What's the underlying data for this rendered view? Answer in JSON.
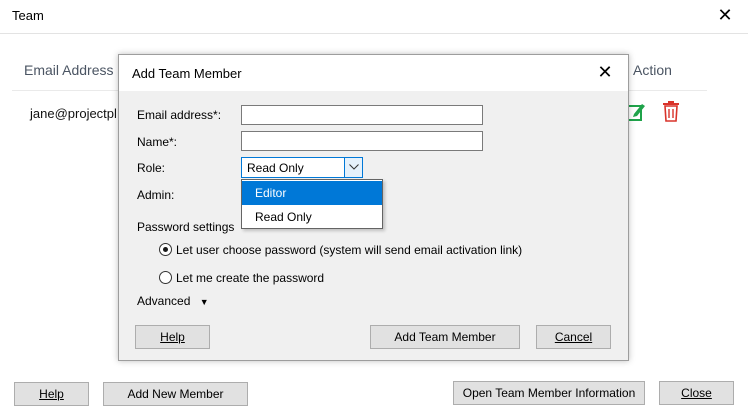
{
  "window": {
    "title": "Team",
    "close_glyph": "✕"
  },
  "table": {
    "columns": {
      "email": "Email Address",
      "action": "Action"
    },
    "rows": [
      {
        "email": "jane@projectpl"
      }
    ],
    "icons": [
      "edit-icon",
      "trash-icon"
    ]
  },
  "footer": {
    "help_label": "Help",
    "add_new_member_label": "Add New Member",
    "open_info_label": "Open Team Member Information",
    "close_label": "Close"
  },
  "dialog": {
    "title": "Add Team Member",
    "close_glyph": "✕",
    "email_label": "Email address*:",
    "email_value": "",
    "name_label": "Name*:",
    "name_value": "",
    "role_label": "Role:",
    "role_value": "Read Only",
    "role_options": [
      "Editor",
      "Read Only"
    ],
    "role_highlighted": "Editor",
    "admin_label": "Admin:",
    "password_settings_label": "Password settings",
    "radio_options": [
      {
        "label": "Let user choose password (system will send email activation link)",
        "checked": true
      },
      {
        "label": "Let me create the password",
        "checked": false
      }
    ],
    "advanced_label": "Advanced",
    "advanced_glyph": "▼",
    "help_label": "Help",
    "add_team_member_label": "Add Team Member",
    "cancel_label": "Cancel"
  },
  "colors": {
    "accent": "#0078d7",
    "edit_icon": "#1fa34a",
    "trash_icon": "#d9342b",
    "button_bg": "#e1e1e1",
    "dialog_bg": "#f0f0f0"
  }
}
